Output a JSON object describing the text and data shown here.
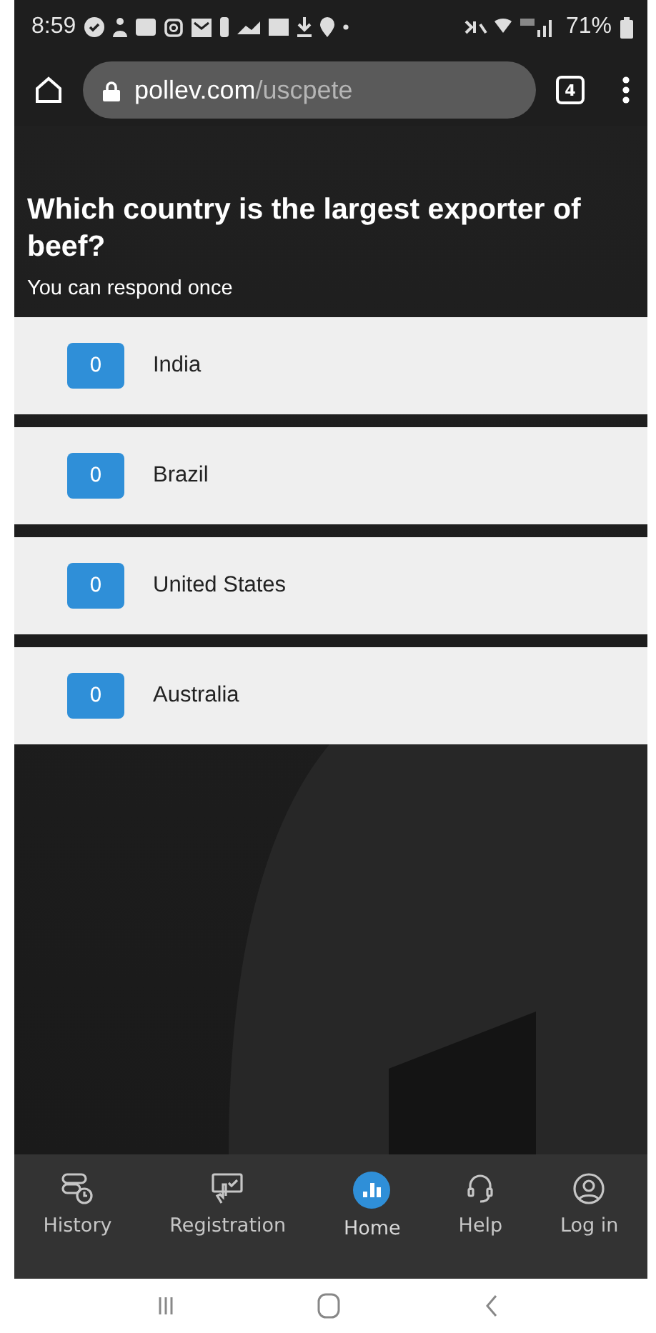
{
  "status_bar": {
    "time": "8:59",
    "battery": "71%"
  },
  "browser": {
    "domain": "pollev.com",
    "path": "/uscpete",
    "tab_count": "4"
  },
  "poll": {
    "question": "Which country is the largest exporter of beef?",
    "note": "You can respond once",
    "options": [
      {
        "count": "0",
        "label": "India"
      },
      {
        "count": "0",
        "label": "Brazil"
      },
      {
        "count": "0",
        "label": "United States"
      },
      {
        "count": "0",
        "label": "Australia"
      }
    ]
  },
  "bottom_nav": [
    {
      "kind": "history",
      "label": "History",
      "selected": false
    },
    {
      "kind": "registration",
      "label": "Registration",
      "selected": false
    },
    {
      "kind": "home",
      "label": "Home",
      "selected": true
    },
    {
      "kind": "help",
      "label": "Help",
      "selected": false
    },
    {
      "kind": "login",
      "label": "Log in",
      "selected": false
    }
  ]
}
